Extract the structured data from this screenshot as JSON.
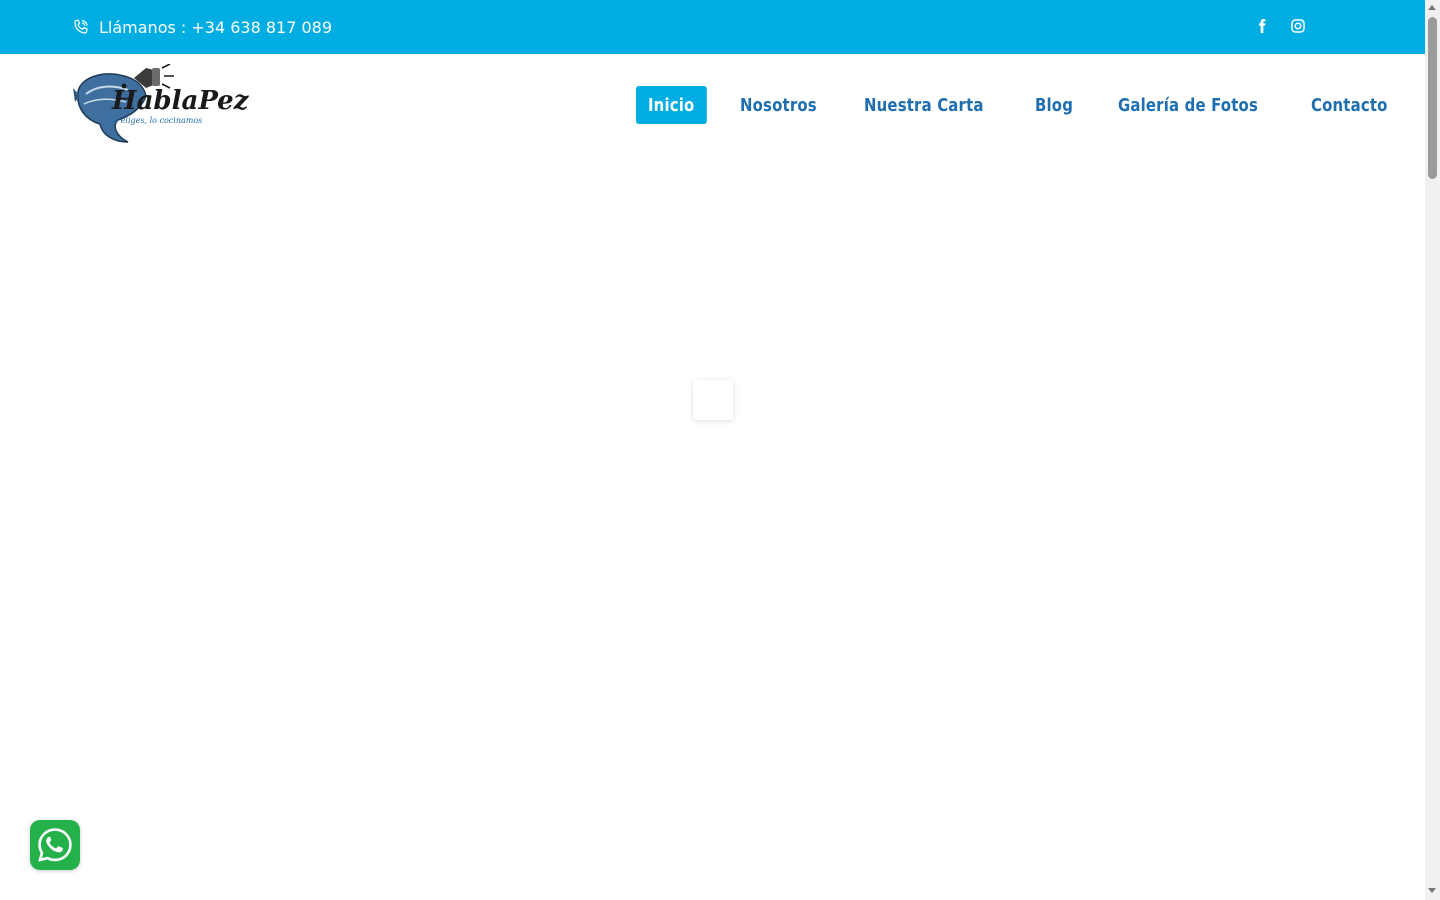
{
  "topbar": {
    "phone_text": "Llámanos : +34 638 817 089",
    "background": "#00ade2",
    "social": [
      "facebook-icon",
      "instagram-icon"
    ]
  },
  "logo": {
    "brand_text": "HablaPez",
    "tagline": "Lo eliges, lo cocinamos"
  },
  "nav": {
    "items": [
      {
        "label": "Inicio",
        "active": true
      },
      {
        "label": "Nosotros",
        "active": false
      },
      {
        "label": "Nuestra Carta",
        "active": false
      },
      {
        "label": "Blog",
        "active": false
      },
      {
        "label": "Galería de Fotos",
        "active": false
      },
      {
        "label": "Contacto",
        "active": false
      }
    ],
    "active_color": "#00ade2",
    "text_color": "#1f6fb0"
  },
  "whatsapp": {
    "icon": "whatsapp-icon",
    "color": "#24b14a"
  }
}
